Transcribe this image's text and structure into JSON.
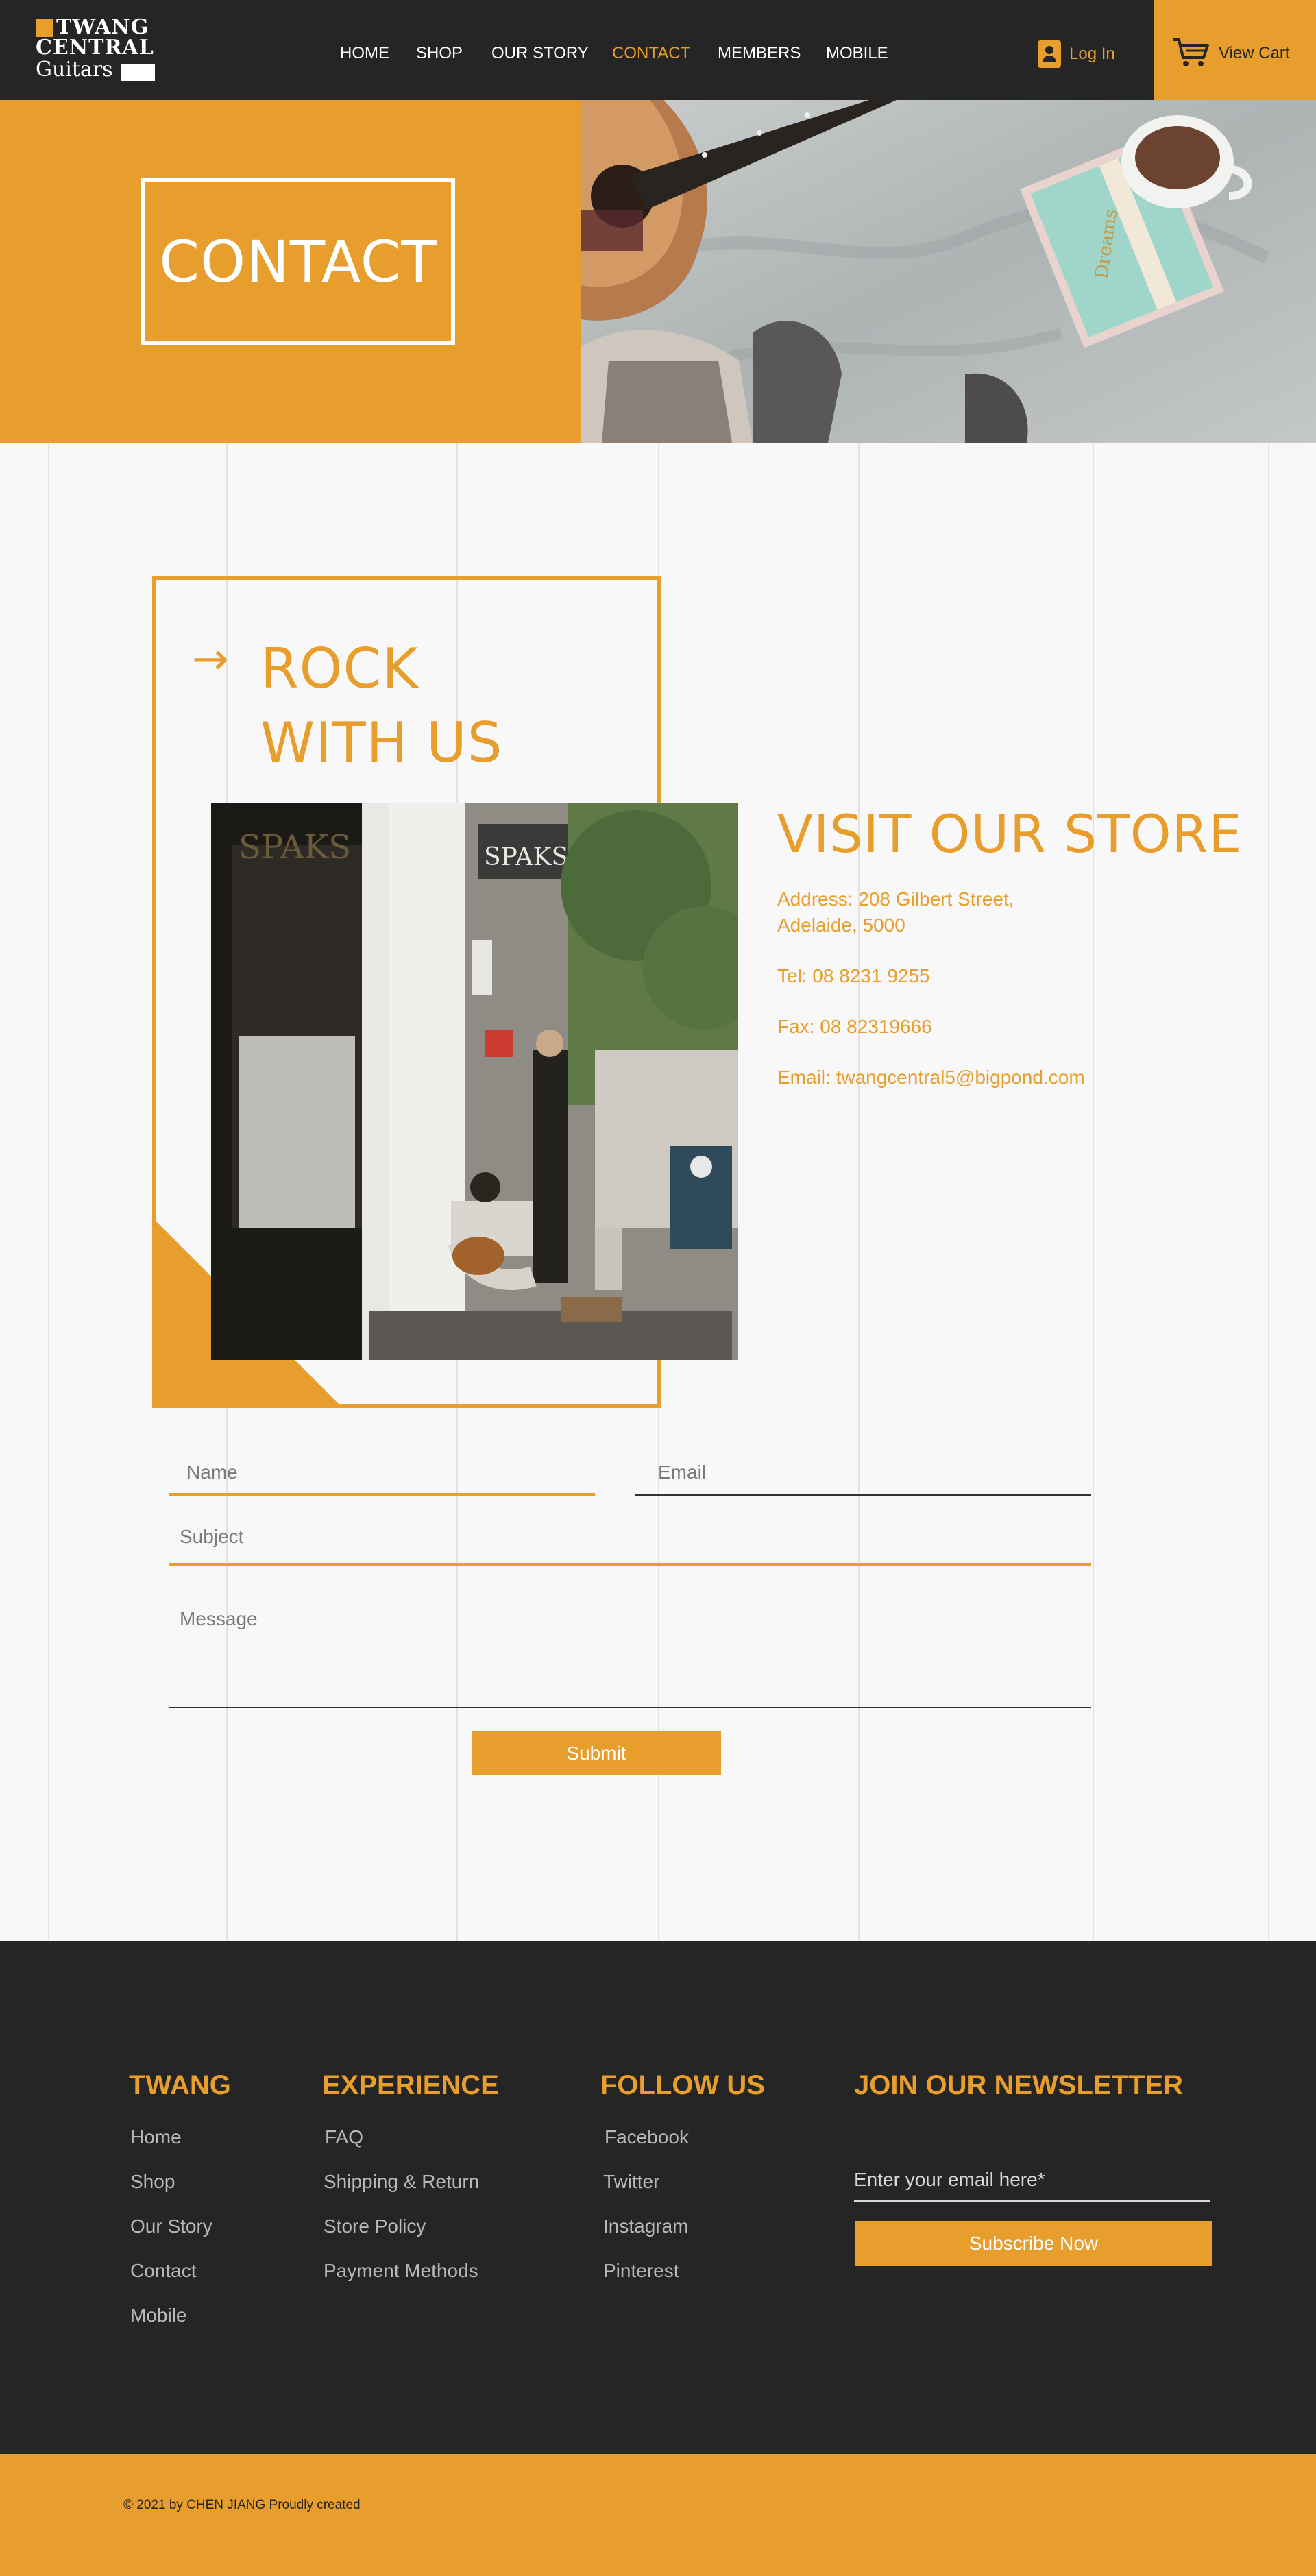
{
  "header": {
    "logo": {
      "line1": "TWANG",
      "line2": "CENTRAL",
      "line3": "Guitars"
    },
    "nav": [
      {
        "label": "HOME",
        "active": false
      },
      {
        "label": "SHOP",
        "active": false
      },
      {
        "label": "OUR STORY",
        "active": false
      },
      {
        "label": "CONTACT",
        "active": true
      },
      {
        "label": "MEMBERS",
        "active": false
      },
      {
        "label": "MOBILE",
        "active": false
      }
    ],
    "login_label": "Log In",
    "cart_label": "View Cart"
  },
  "hero": {
    "title": "CONTACT",
    "photo_icon": "guitar-coffee-blanket-photo"
  },
  "main": {
    "rock_title_line1": "ROCK",
    "rock_title_line2": "WITH US",
    "arrow_icon": "arrow-right-icon",
    "store_photo_icon": "street-busker-storefront-photo",
    "visit_title": "VISIT OUR STORE",
    "address_line1": "Address: 208 Gilbert Street,",
    "address_line2": "Adelaide, 5000",
    "tel": "Tel: 08 8231 9255",
    "fax": "Fax: 08 82319666",
    "email": "Email: twangcentral5@bigpond.com"
  },
  "form": {
    "name_placeholder": "Name",
    "email_placeholder": "Email",
    "subject_placeholder": "Subject",
    "message_placeholder": "Message",
    "submit_label": "Submit"
  },
  "footer": {
    "col1": {
      "title": "TWANG",
      "links": [
        "Home",
        "Shop",
        "Our Story",
        "Contact",
        "Mobile"
      ]
    },
    "col2": {
      "title": "EXPERIENCE",
      "links": [
        "FAQ",
        "Shipping & Return",
        "Store Policy",
        "Payment Methods"
      ]
    },
    "col3": {
      "title": "FOLLOW US",
      "links": [
        "Facebook",
        "Twitter",
        "Instagram",
        "Pinterest"
      ]
    },
    "newsletter": {
      "title": "JOIN OUR NEWSLETTER",
      "placeholder": "Enter your email here*",
      "button_label": "Subscribe Now"
    },
    "copyright": "© 2021 by CHEN JIANG Proudly created"
  },
  "colors": {
    "accent": "#e89e2c",
    "dark": "#252525",
    "background": "#f8f8f8"
  }
}
